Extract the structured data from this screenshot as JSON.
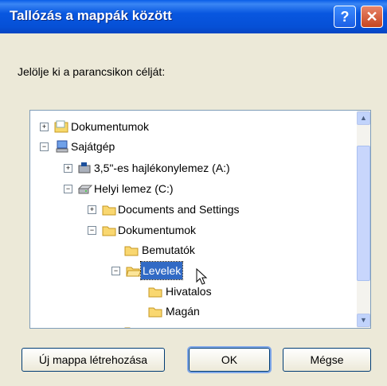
{
  "window": {
    "title": "Tallózás a mappák között",
    "help_label": "?",
    "close_label": "✕"
  },
  "prompt": "Jelölje ki a parancsikon célját:",
  "tree": {
    "items": [
      {
        "label": "Dokumentumok",
        "icon": "documents-folder-icon",
        "expander": "⊞"
      },
      {
        "label": "Sajátgép",
        "icon": "my-computer-icon",
        "expander": "⊟"
      },
      {
        "label": "3,5\"-es hajlékonylemez (A:)",
        "icon": "floppy-drive-icon",
        "expander": "⊞"
      },
      {
        "label": "Helyi lemez (C:)",
        "icon": "hard-drive-icon",
        "expander": "⊟"
      },
      {
        "label": "Documents and Settings",
        "icon": "folder-icon",
        "expander": "⊞"
      },
      {
        "label": "Dokumentumok",
        "icon": "folder-icon",
        "expander": "⊟"
      },
      {
        "label": "Bemutatók",
        "icon": "folder-icon",
        "expander": ""
      },
      {
        "label": "Levelek",
        "icon": "open-folder-icon",
        "expander": "⊟",
        "selected": true
      },
      {
        "label": "Hivatalos",
        "icon": "folder-icon",
        "expander": ""
      },
      {
        "label": "Magán",
        "icon": "folder-icon",
        "expander": ""
      }
    ]
  },
  "buttons": {
    "new_folder": "Új mappa létrehozása",
    "ok": "OK",
    "cancel": "Mégse"
  }
}
